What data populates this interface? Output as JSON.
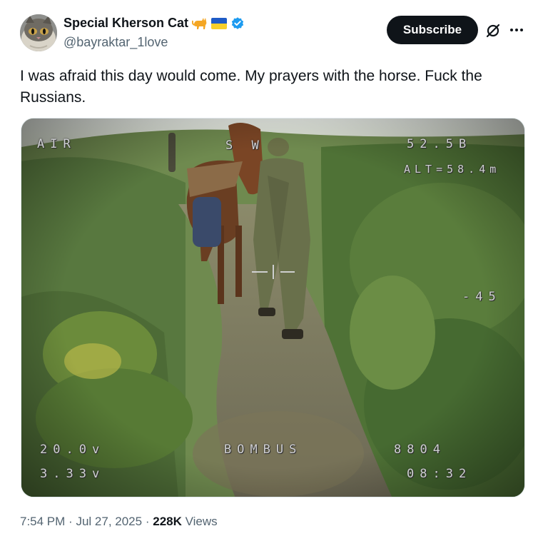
{
  "author": {
    "display_name": "Special Kherson Cat",
    "handle": "@bayraktar_1love",
    "verified": true,
    "emoji": [
      "cat-emoji",
      "ukraine-flag-emoji"
    ]
  },
  "actions": {
    "subscribe_label": "Subscribe"
  },
  "tweet": {
    "text": "I was afraid this day would come. My prayers with the horse. Fuck the Russians."
  },
  "osd": {
    "air": "AIR",
    "sw": "S W",
    "alt_top": "52.5B",
    "alt": "ALT=58.4m",
    "pitch": "-45",
    "battery_voltage": "20.0v",
    "cell_voltage": "3.33v",
    "craft_name": "BOMBUS",
    "mah": "8804",
    "flight_time": "08:32"
  },
  "meta": {
    "time": "7:54 PM",
    "separator": "·",
    "date": "Jul 27, 2025",
    "views_count": "228K",
    "views_label": "Views"
  },
  "colors": {
    "verified_blue": "#1d9bf0",
    "subscribe_bg": "#0f1419",
    "secondary_text": "#536471"
  }
}
